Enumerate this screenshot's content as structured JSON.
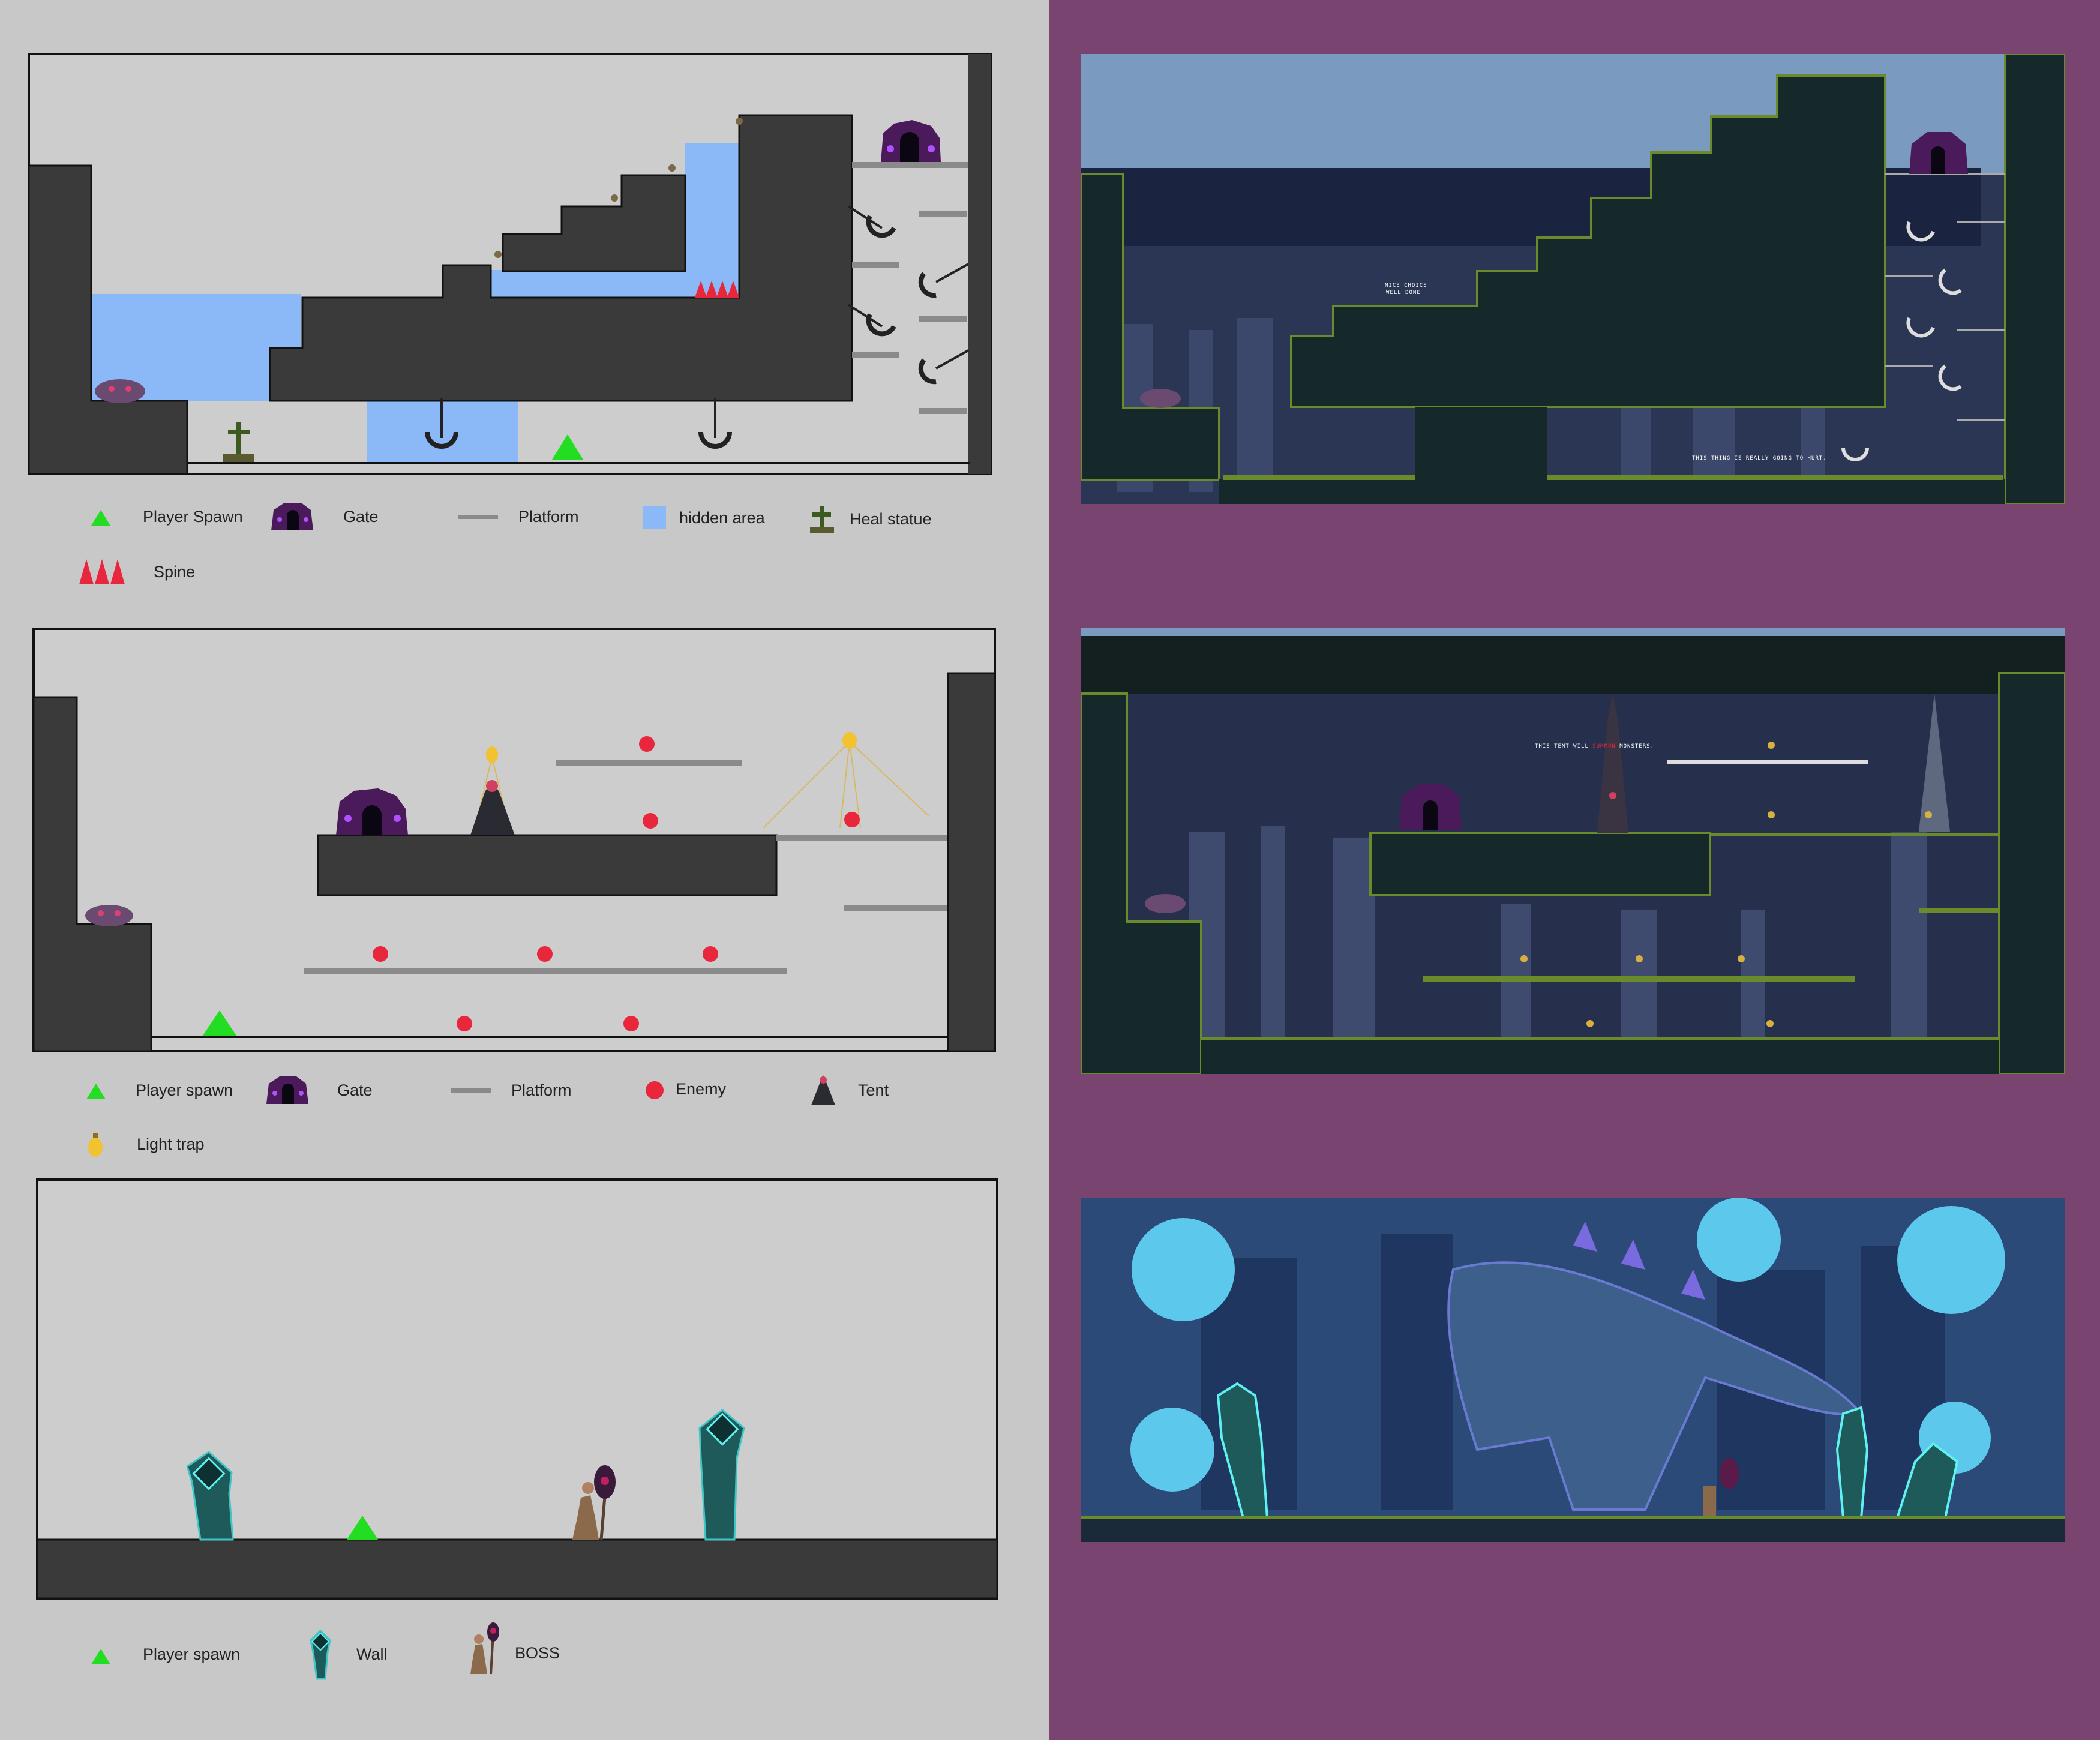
{
  "colors": {
    "left_panel": "#c8c8c8",
    "right_panel": "#7a4470",
    "ground": "#3a3a3a",
    "hidden_area": "#8bb8f7",
    "platform": "#8a8a8a",
    "spawn": "#22dd22",
    "spine": "#e8263c",
    "enemy": "#e8263c",
    "light_trap": "#f2c230"
  },
  "level1": {
    "legend": {
      "player_spawn": "Player Spawn",
      "gate": "Gate",
      "platform": "Platform",
      "hidden_area": "hidden area",
      "heal_statue": "Heal statue",
      "spine": "Spine"
    },
    "screenshot_text": {
      "nice_choice_1": "NICE CHOICE",
      "nice_choice_2": "WELL DONE",
      "hurt": "THIS THING IS REALLY GOING TO HURT."
    }
  },
  "level2": {
    "legend": {
      "player_spawn": "Player spawn",
      "gate": "Gate",
      "platform": "Platform",
      "enemy": "Enemy",
      "tent": "Tent",
      "light_trap": "Light trap"
    },
    "screenshot_text": {
      "tent_pre": "THIS TENT WILL ",
      "tent_red": "SUMMON",
      "tent_post": " MONSTERS."
    }
  },
  "level3": {
    "legend": {
      "player_spawn": "Player spawn",
      "wall": "Wall",
      "boss": "BOSS"
    }
  }
}
